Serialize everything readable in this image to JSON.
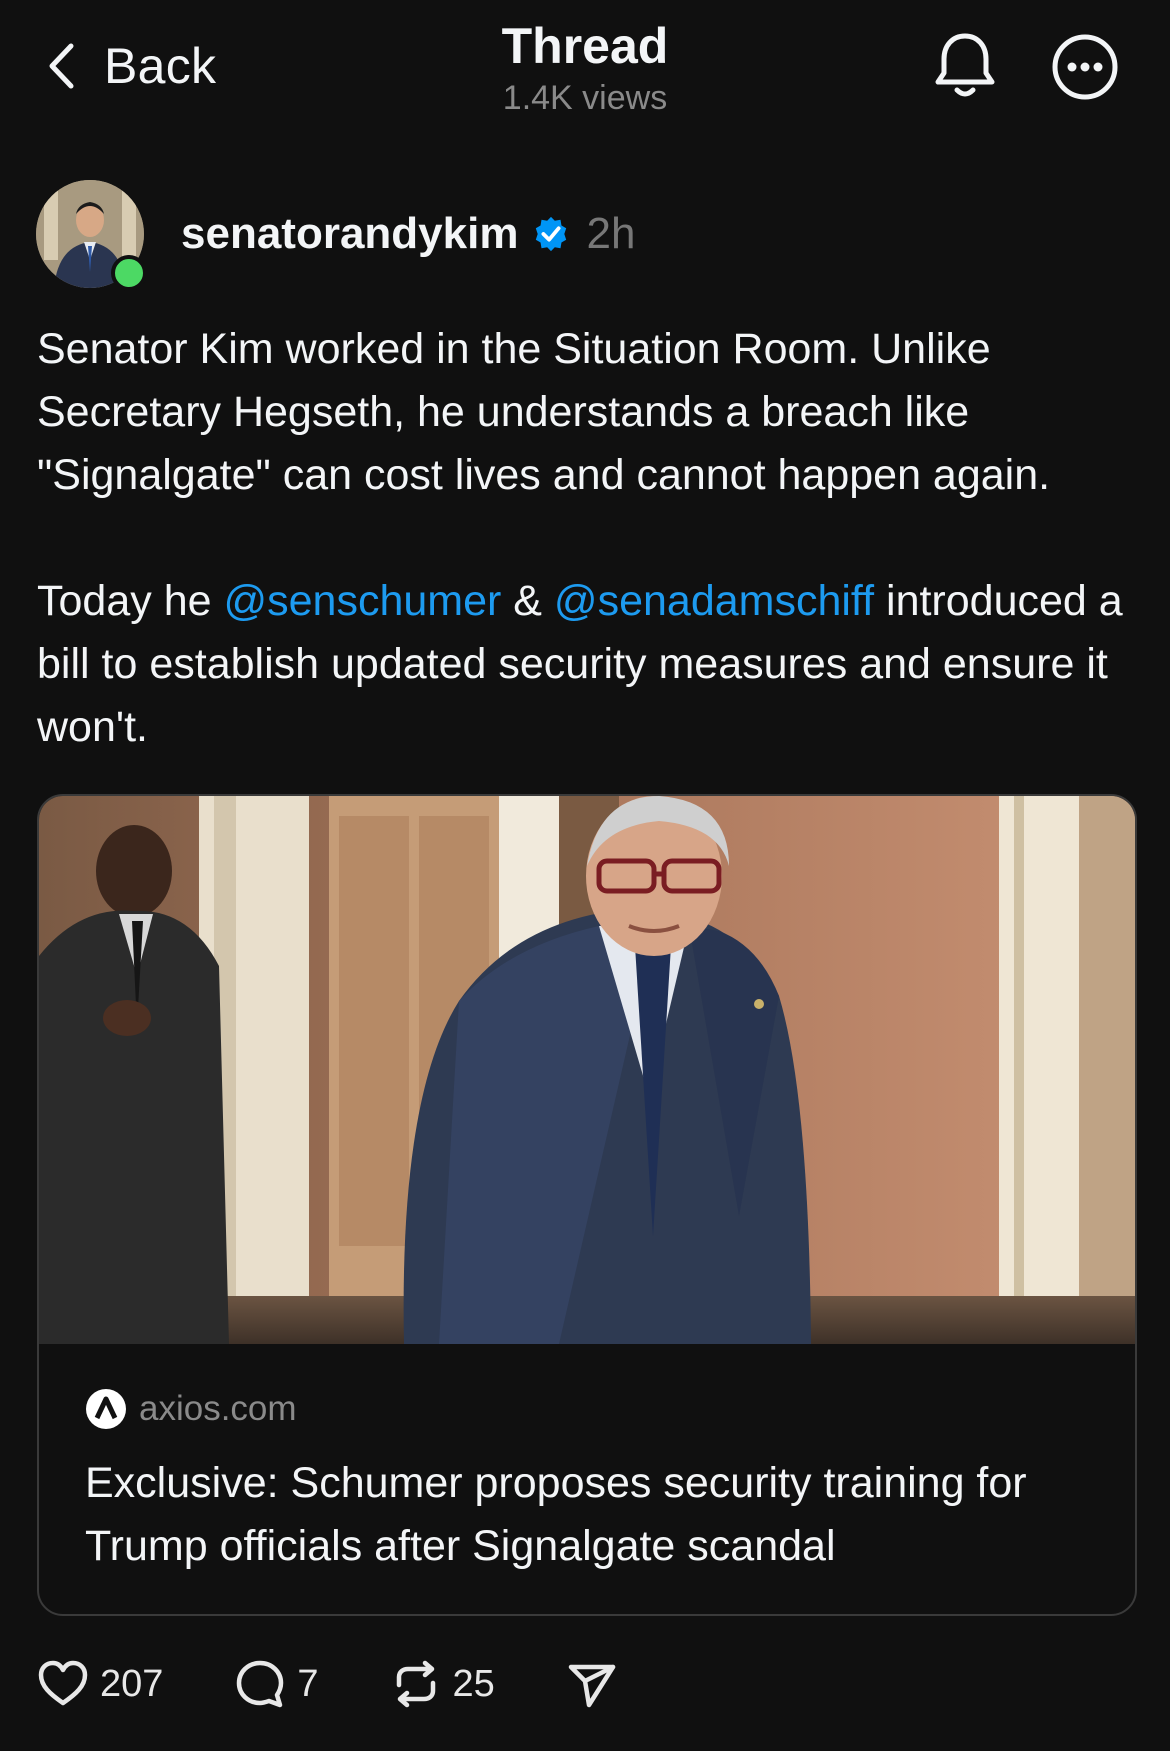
{
  "header": {
    "back_label": "Back",
    "title": "Thread",
    "views": "1.4K views",
    "icons": [
      "chevron-left-icon",
      "bell-icon",
      "more-icon"
    ]
  },
  "post": {
    "author": {
      "username": "senatorandykim",
      "verified": true,
      "time": "2h",
      "online": true
    },
    "paragraph_1": "Senator Kim worked in the Situation Room. Unlike Secretary Hegseth, he understands a breach like \"Signalgate\" can cost lives and cannot happen again.",
    "paragraph_2": {
      "lead": "Today he ",
      "mention_1": "@senschumer",
      "joiner": " & ",
      "mention_2": "@senadamschiff",
      "tail": " introduced a bill to establish updated security measures and ensure it won't."
    },
    "link_card": {
      "source": "axios.com",
      "title": "Exclusive: Schumer proposes security training for Trump officials after Signalgate scandal"
    },
    "actions": {
      "likes": "207",
      "replies": "7",
      "reposts": "25"
    }
  },
  "colors": {
    "background": "#101010",
    "text": "#f3f5f7",
    "muted": "#777777",
    "mention": "#1d9bf0",
    "verified": "#0095f6",
    "online": "#4cd964",
    "card_border": "#3a3a3a"
  }
}
